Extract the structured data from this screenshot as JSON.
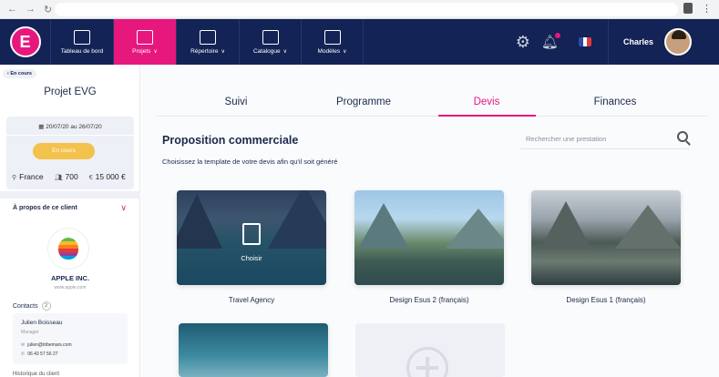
{
  "header": {
    "nav": [
      {
        "label": "Tableau de bord",
        "has_chevron": false,
        "active": false
      },
      {
        "label": "Projets",
        "has_chevron": true,
        "active": true
      },
      {
        "label": "Répertoire",
        "has_chevron": true,
        "active": false
      },
      {
        "label": "Catalogue",
        "has_chevron": true,
        "active": false
      },
      {
        "label": "Modèles",
        "has_chevron": true,
        "active": false
      }
    ],
    "user_name": "Charles",
    "brand_color": "#e6187e",
    "bar_color": "#132355"
  },
  "sidebar": {
    "status_tag": "En cours",
    "project_title": "Projet EVG",
    "dates": "20/07/20 au 26/07/20",
    "status_badge": "En cours",
    "location": "France",
    "people": "700",
    "budget": "15 000 €",
    "about_title": "À propos de ce client",
    "client_name": "APPLE INC.",
    "client_url": "www.apple.com",
    "contacts_label": "Contacts",
    "contacts_count": "2",
    "contact": {
      "name": "Julien Boisseau",
      "role": "Manager",
      "email": "julien@tribemars.com",
      "phone": "06 43 57 56 27"
    },
    "more_label": "Historique du client"
  },
  "tabs": [
    {
      "label": "Suivi",
      "active": false
    },
    {
      "label": "Programme",
      "active": false
    },
    {
      "label": "Devis",
      "active": true
    },
    {
      "label": "Finances",
      "active": false
    }
  ],
  "main": {
    "title": "Proposition commerciale",
    "subtitle": "Choisissez la template de votre devis afin qu'il soit généré",
    "search_placeholder": "Rechercher une prestation",
    "choose_label": "Choisir",
    "templates": [
      {
        "label": "Travel Agency"
      },
      {
        "label": "Design Esus 2 (français)"
      },
      {
        "label": "Design Esus 1 (français)"
      }
    ]
  }
}
